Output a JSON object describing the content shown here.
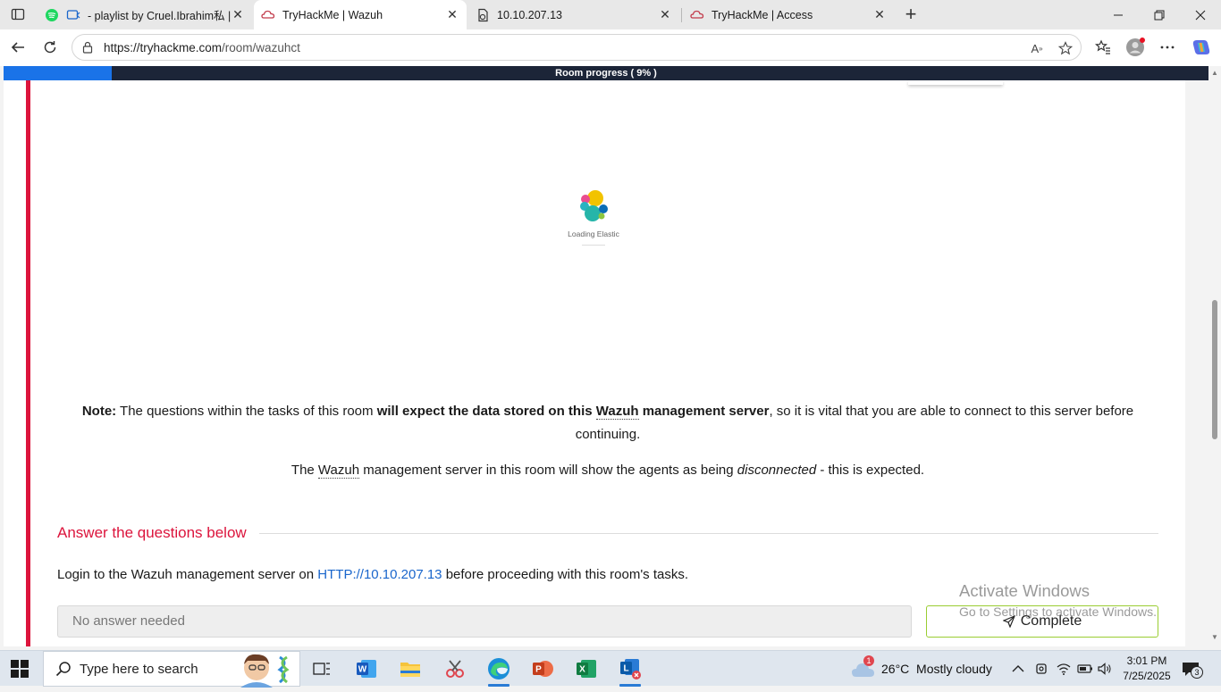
{
  "browser": {
    "tabs": [
      {
        "title": "- playlist by Cruel.Ibrahim私 |",
        "favicon": "spotify-icon"
      },
      {
        "title": "TryHackMe | Wazuh",
        "favicon": "tryhackme-icon",
        "active": true
      },
      {
        "title": "10.10.207.13",
        "favicon": "page-icon"
      },
      {
        "title": "TryHackMe | Access",
        "favicon": "tryhackme-icon"
      }
    ],
    "url_host": "https://tryhackme.com",
    "url_path": "/room/wazuhct"
  },
  "room": {
    "progress_label": "Room progress ( 9% )",
    "progress_fraction": 0.09
  },
  "loading": {
    "label": "Loading Elastic"
  },
  "content": {
    "note_label": "Note:",
    "note_text1": " The questions within the tasks of this room ",
    "note_bold": "will expect the data stored on this ",
    "note_bold_wazuh": "Wazuh",
    "note_bold_end": " management server",
    "note_text2": ", so it is vital that you are able to connect to this server before continuing.",
    "note2_pre": "The ",
    "note2_wazuh": "Wazuh",
    "note2_mid": " management server in this room will show the agents as being ",
    "note2_em": "disconnected",
    "note2_end": " - this is expected."
  },
  "questions": {
    "heading": "Answer the questions below",
    "q1_pre": "Login to the Wazuh management server on ",
    "q1_link": "HTTP://10.10.207.13",
    "q1_post": " before proceeding with this room's tasks.",
    "answer_placeholder": "No answer needed",
    "complete_label": "Complete"
  },
  "watermark": {
    "line1": "Activate Windows",
    "line2": "Go to Settings to activate Windows."
  },
  "taskbar": {
    "search_placeholder": "Type here to search",
    "weather_badge": "1",
    "weather": "26°C  Mostly cloudy",
    "time": "3:01 PM",
    "date": "7/25/2025",
    "notifications": "3"
  },
  "colors": {
    "accent_red": "#dc143c",
    "progress_bg": "#1c2538",
    "progress_fill": "#1a73e8",
    "link": "#1a66cc",
    "complete_border": "#9acd32"
  }
}
